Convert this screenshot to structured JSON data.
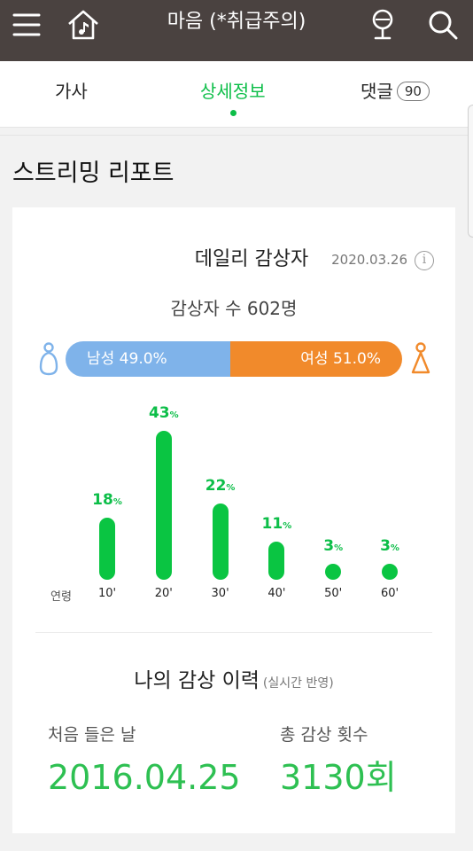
{
  "header": {
    "title": "마음 (*취급주의)",
    "icons": [
      "menu-icon",
      "home-music-icon",
      "microphone-icon",
      "search-icon"
    ],
    "bg_color": "#4a4240"
  },
  "tabs": [
    {
      "label": "가사",
      "active": false
    },
    {
      "label": "상세정보",
      "active": true
    },
    {
      "label": "댓글",
      "count": "90",
      "active": false
    }
  ],
  "accent_color": "#0cbe48",
  "section_title": "스트리밍 리포트",
  "daily": {
    "title": "데일리 감상자",
    "date": "2020.03.26",
    "listeners": "감상자 수 602명",
    "male_label": "남성 49.0%",
    "female_label": "여성 51.0%",
    "male_share": 0.49,
    "male_color": "#7fb3ea",
    "female_color": "#f18a2b"
  },
  "chart_data": {
    "type": "bar",
    "xlabel": "연령",
    "categories": [
      "10'",
      "20'",
      "30'",
      "40'",
      "50'",
      "60'"
    ],
    "values": [
      18,
      43,
      22,
      11,
      3,
      3
    ],
    "unit": "%"
  },
  "history": {
    "title": "나의 감상 이력",
    "subtitle": "(실시간 반영)",
    "first_label": "처음 들은 날",
    "first_value": "2016.04.25",
    "count_label": "총 감상 횟수",
    "count_value": "3130회"
  }
}
